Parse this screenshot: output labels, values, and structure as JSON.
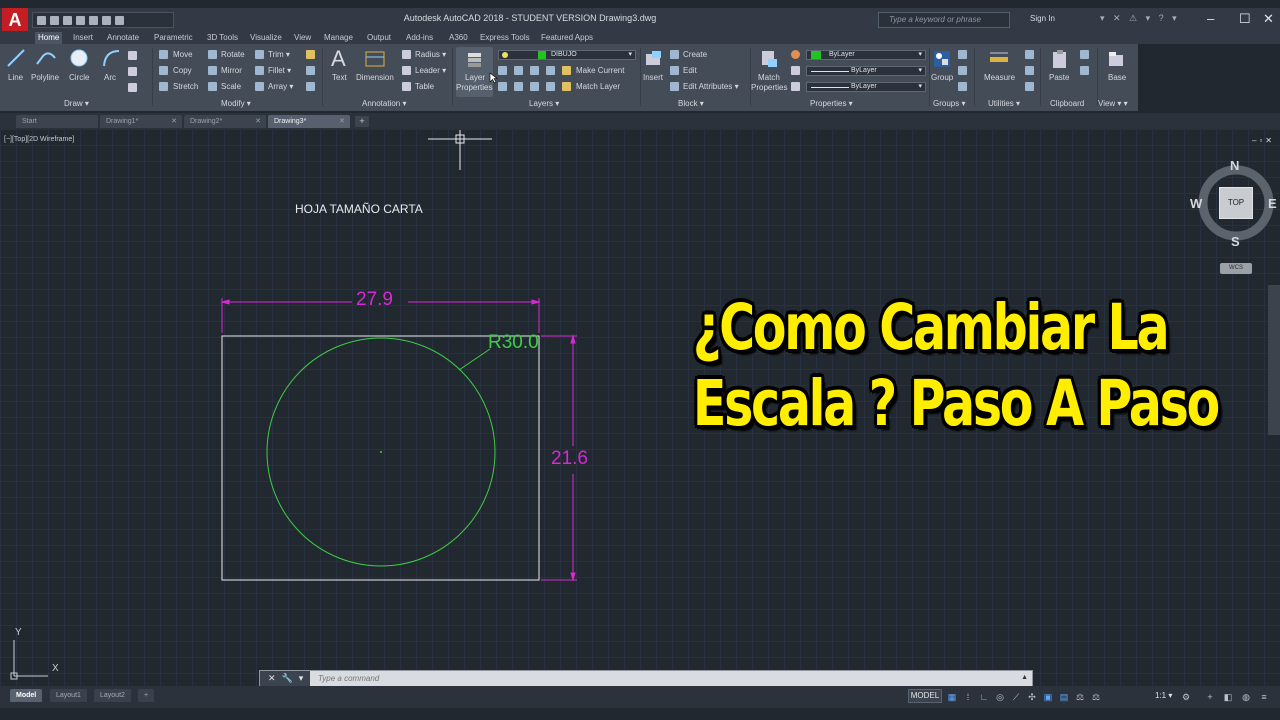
{
  "titlebar": {
    "app_letter": "A",
    "title": "Autodesk AutoCAD 2018 - STUDENT VERSION     Drawing3.dwg",
    "search_placeholder": "Type a keyword or phrase",
    "signin": "Sign In"
  },
  "ribbon_tabs": [
    "Home",
    "Insert",
    "Annotate",
    "Parametric",
    "3D Tools",
    "Visualize",
    "View",
    "Manage",
    "Output",
    "Add-ins",
    "A360",
    "Express Tools",
    "Featured Apps"
  ],
  "ribbon": {
    "draw": {
      "title": "Draw ▾",
      "line": "Line",
      "polyline": "Polyline",
      "circle": "Circle",
      "arc": "Arc"
    },
    "modify": {
      "title": "Modify ▾",
      "move": "Move",
      "rotate": "Rotate",
      "trim": "Trim ▾",
      "copy": "Copy",
      "mirror": "Mirror",
      "fillet": "Fillet ▾",
      "stretch": "Stretch",
      "scale": "Scale",
      "array": "Array ▾"
    },
    "annotation": {
      "title": "Annotation ▾",
      "text": "Text",
      "dimension": "Dimension",
      "radius": "Radius ▾",
      "leader": "Leader ▾",
      "table": "Table"
    },
    "layers": {
      "title": "Layers ▾",
      "layer_properties_1": "Layer",
      "layer_properties_2": "Properties",
      "current_layer": "DIBUJO",
      "make_current": "Make Current",
      "match_layer": "Match Layer"
    },
    "block": {
      "title": "Block ▾",
      "insert": "Insert",
      "create": "Create",
      "edit": "Edit",
      "edit_attributes": "Edit Attributes ▾"
    },
    "properties": {
      "title": "Properties ▾",
      "match_1": "Match",
      "match_2": "Properties",
      "color": "ByLayer",
      "linetype": "ByLayer",
      "lineweight": "ByLayer"
    },
    "groups": {
      "title": "Groups ▾",
      "group": "Group"
    },
    "utilities": {
      "title": "Utilities ▾",
      "measure": "Measure"
    },
    "clipboard": {
      "title": "Clipboard",
      "paste": "Paste"
    },
    "view": {
      "title": "View ▾ ▾",
      "base": "Base"
    }
  },
  "doc_tabs": [
    "Start",
    "Drawing1*",
    "Drawing2*",
    "Drawing3*"
  ],
  "viewport_label": "[−][Top][2D Wireframe]",
  "drawing": {
    "sheet_label": "HOJA TAMAÑO CARTA",
    "width_dim": "27.9",
    "height_dim": "21.6",
    "radius_dim": "R30.0"
  },
  "viewcube": {
    "face": "TOP",
    "north": "N",
    "south": "S",
    "east": "E",
    "west": "W",
    "wcs": "WCS"
  },
  "banner": {
    "line1": "¿Como Cambiar La",
    "line2": "Escala ? Paso A Paso"
  },
  "ucs": {
    "x": "X",
    "y": "Y"
  },
  "command": {
    "placeholder": "Type a command"
  },
  "layout_tabs": [
    "Model",
    "Layout1",
    "Layout2"
  ],
  "status": {
    "model": "MODEL",
    "scale": "1:1 ▾"
  },
  "colors": {
    "dimension": "#d62ad3",
    "circle": "#3ecf44",
    "banner": "#ffee00",
    "layer_swatch": "#22c422",
    "background": "#212830"
  }
}
